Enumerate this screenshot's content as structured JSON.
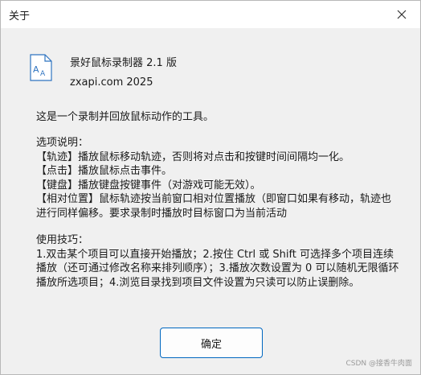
{
  "dialog": {
    "title": "关于",
    "app_name": "景好鼠标录制器  2.1 版",
    "app_version": "zxapi.com 2025",
    "description": "这是一个录制并回放鼠标动作的工具。",
    "options_heading": "选项说明：",
    "options": [
      "【轨迹】播放鼠标移动轨迹，否则将对点击和按键时间间隔均一化。",
      "【点击】播放鼠标点击事件。",
      "【键盘】播放键盘按键事件（对游戏可能无效）。",
      "【相对位置】鼠标轨迹按当前窗口相对位置播放（即窗口如果有移动，轨迹也进行同样偏移。要求录制时播放时目标窗口为当前活动"
    ],
    "tips_heading": "使用技巧：",
    "tips_text": "1.双击某个项目可以直接开始播放；2.按住 Ctrl 或 Shift 可选择多个项目连续播放（还可通过修改名称来排列顺序）；3.播放次数设置为 0 可以随机无限循环播放所选项目；4.浏览目录找到项目文件设置为只读可以防止误删除。",
    "ok_label": "确定"
  },
  "watermark": "CSDN @接香牛肉面",
  "icons": {
    "close": "close-icon",
    "app": "document-font-icon"
  },
  "colors": {
    "dialog_bg": "#f0f0f0",
    "titlebar_bg": "#ffffff",
    "button_border": "#0067c0",
    "icon_blue": "#2f74c0"
  }
}
